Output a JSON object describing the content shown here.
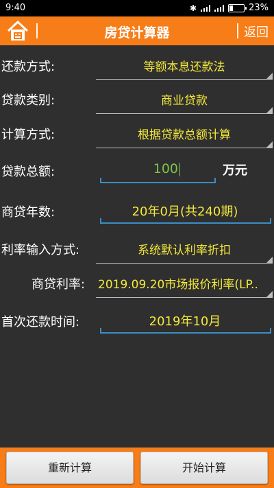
{
  "status": {
    "time": "9:40",
    "battery": "23%"
  },
  "header": {
    "title": "房贷计算器",
    "back_label": "返回"
  },
  "form": {
    "repay_method_label": "还款方式:",
    "repay_method_value": "等额本息还款法",
    "loan_type_label": "贷款类别:",
    "loan_type_value": "商业贷款",
    "calc_method_label": "计算方式:",
    "calc_method_value": "根据贷款总额计算",
    "total_label": "贷款总额:",
    "total_value": "100",
    "total_unit": "万元",
    "years_label": "商贷年数:",
    "years_value": "20年0月(共240期)",
    "rate_input_label": "利率输入方式:",
    "rate_input_value": "系统默认利率折扣",
    "rate_label": "商贷利率:",
    "rate_value": "2019.09.20市场报价利率(LP..",
    "first_repay_label": "首次还款时间:",
    "first_repay_value": "2019年10月"
  },
  "buttons": {
    "recalc": "重新计算",
    "start": "开始计算"
  }
}
